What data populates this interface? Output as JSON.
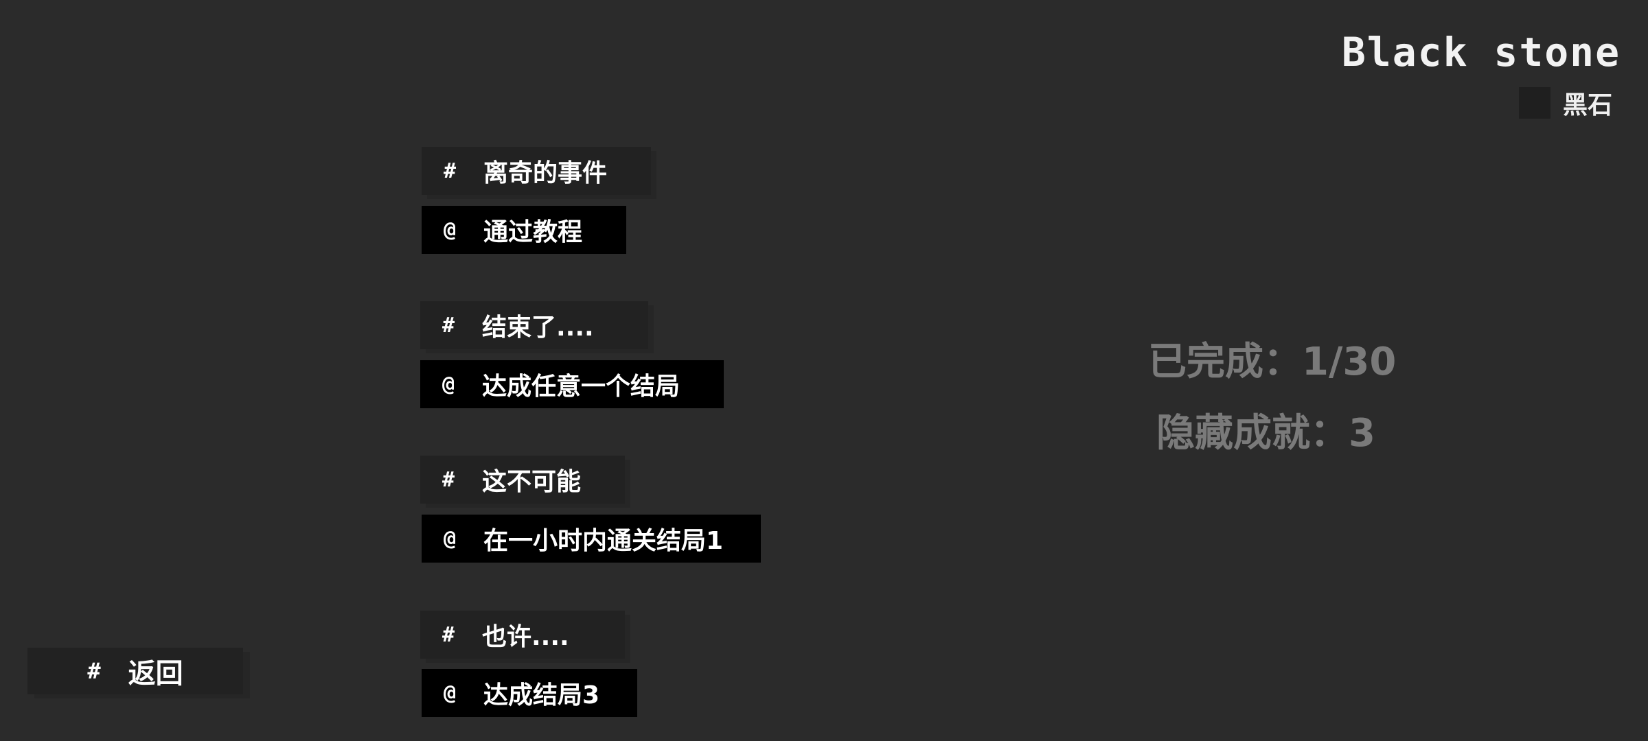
{
  "header": {
    "title": "Black stone",
    "legend_label": "黑石",
    "legend_color": "#1f1f1f"
  },
  "achievements": [
    {
      "name_symbol": "#",
      "name": "离奇的事件",
      "desc_symbol": "@",
      "desc": "通过教程"
    },
    {
      "name_symbol": "#",
      "name": "结束了....",
      "desc_symbol": "@",
      "desc": "达成任意一个结局"
    },
    {
      "name_symbol": "#",
      "name": "这不可能",
      "desc_symbol": "@",
      "desc": "在一小时内通关结局1"
    },
    {
      "name_symbol": "#",
      "name": "也许....",
      "desc_symbol": "@",
      "desc": "达成结局3"
    }
  ],
  "stats": {
    "completed": "已完成：1/30",
    "hidden": "隐藏成就：3"
  },
  "back_button": {
    "symbol": "#",
    "label": "返回"
  },
  "colors": {
    "background": "#2b2b2b",
    "name_box": "#222222",
    "desc_box": "#000000",
    "stats_text": "#7a7a7a"
  }
}
